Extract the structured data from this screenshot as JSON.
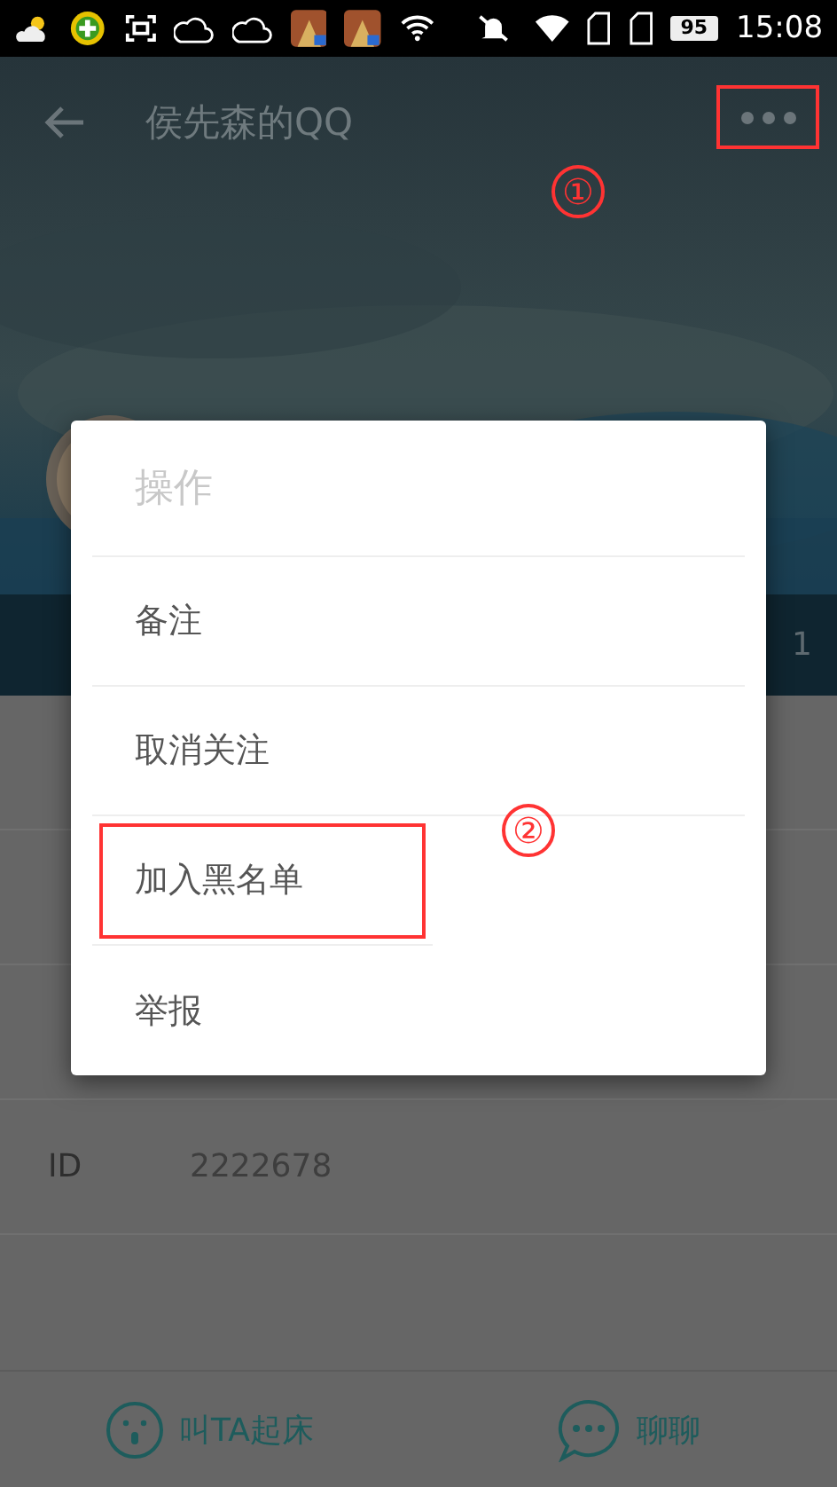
{
  "status_bar": {
    "battery": "95",
    "time": "15:08"
  },
  "header": {
    "title": "侯先森的QQ",
    "more_highlighted": true
  },
  "stats_bar": {
    "right_text": "1"
  },
  "rows": [
    {
      "label": "ID",
      "value": "2222678"
    }
  ],
  "dialog": {
    "title": "操作",
    "items": [
      {
        "label": "备注",
        "highlighted": false
      },
      {
        "label": "取消关注",
        "highlighted": false
      },
      {
        "label": "加入黑名单",
        "highlighted": true
      },
      {
        "label": "举报",
        "highlighted": false
      }
    ]
  },
  "bottom_bar": [
    {
      "kind": "wake",
      "label": "叫TA起床"
    },
    {
      "kind": "chat",
      "label": "聊聊"
    }
  ],
  "annotations": [
    {
      "label": "①"
    },
    {
      "label": "②"
    }
  ]
}
